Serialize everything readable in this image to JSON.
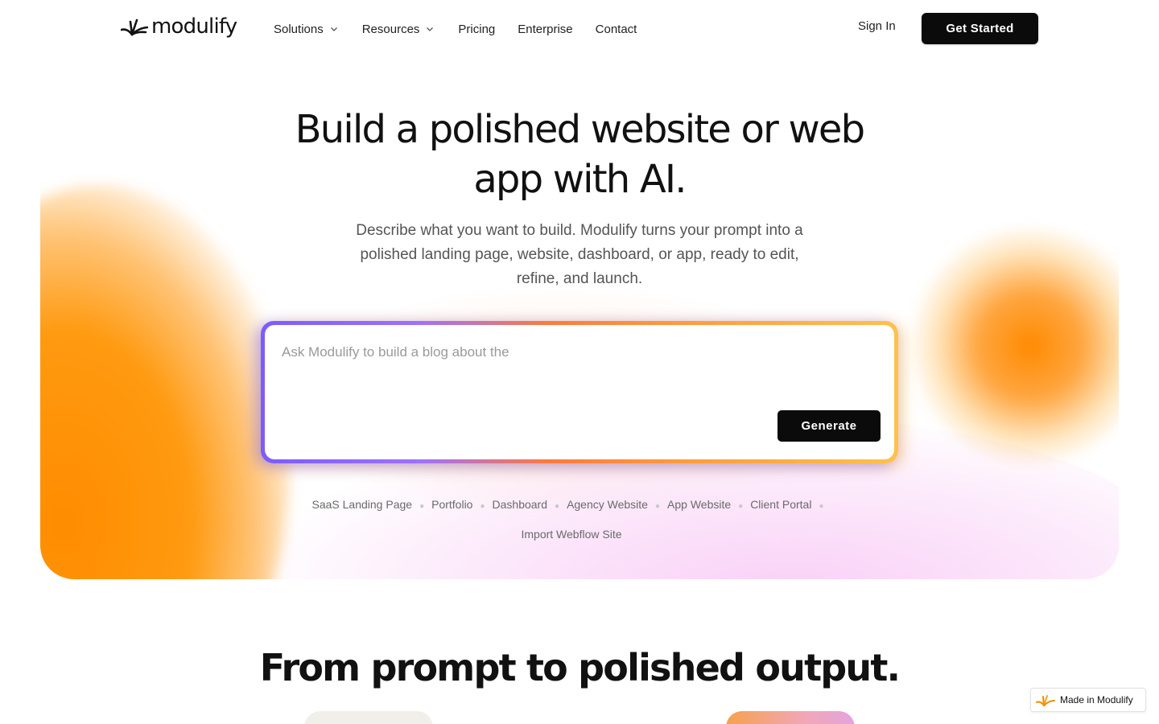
{
  "brand": {
    "name": "modulify",
    "logo_icon": "modulify-logo-icon"
  },
  "nav": {
    "links": [
      {
        "label": "Solutions",
        "has_dropdown": true
      },
      {
        "label": "Resources",
        "has_dropdown": true
      },
      {
        "label": "Pricing",
        "has_dropdown": false
      },
      {
        "label": "Enterprise",
        "has_dropdown": false
      },
      {
        "label": "Contact",
        "has_dropdown": false
      }
    ],
    "sign_in": "Sign In",
    "get_started": "Get Started"
  },
  "hero": {
    "title_line1": "Build a polished website or web",
    "title_line2": "app with AI.",
    "subtitle": "Describe what you want to build. Modulify turns your prompt into a polished landing page, website, dashboard, or app, ready to edit, refine, and launch.",
    "prompt_placeholder": "Ask Modulify to build a blog about the",
    "generate_label": "Generate",
    "suggestions": [
      "SaaS Landing Page",
      "Portfolio",
      "Dashboard",
      "Agency Website",
      "App Website",
      "Client Portal",
      "Import Webflow Site"
    ]
  },
  "section": {
    "title": "From prompt to polished output."
  },
  "badge": {
    "label": "Made in Modulify"
  },
  "colors": {
    "accent_dark": "#0b0b0b",
    "orange": "#ff8c00",
    "purple": "#7b5cff",
    "pink": "#f8c8f5"
  }
}
